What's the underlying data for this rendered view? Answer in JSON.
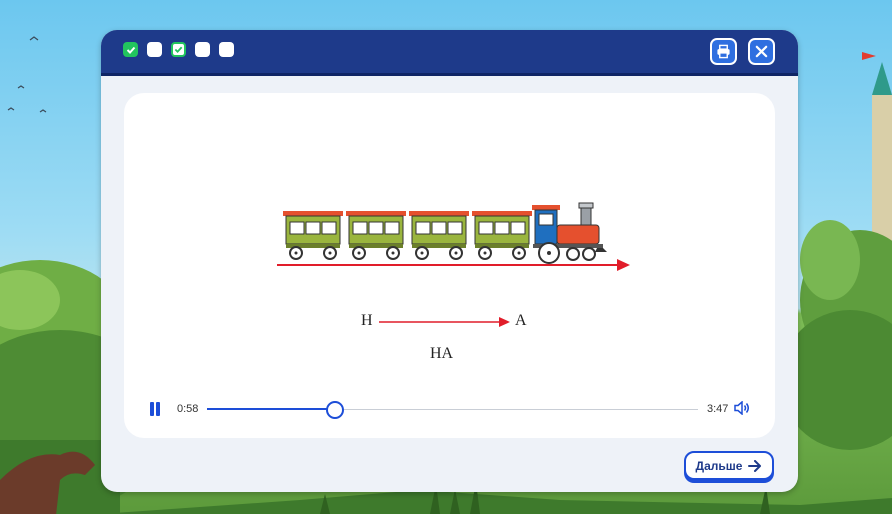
{
  "progress_steps": [
    {
      "state": "completed"
    },
    {
      "state": "pending"
    },
    {
      "state": "completed-outline"
    },
    {
      "state": "pending"
    },
    {
      "state": "pending"
    }
  ],
  "header": {
    "print_icon": "printer-icon",
    "close_icon": "close-icon"
  },
  "diagram": {
    "from_letter": "Н",
    "to_letter": "А",
    "result": "НА",
    "arrow_color": "#e11d2a"
  },
  "player": {
    "elapsed": "0:58",
    "duration": "3:47",
    "progress": 0.26
  },
  "next_button": {
    "label": "Дальше"
  },
  "colors": {
    "accent": "#1d4ed8",
    "header": "#1e3a8a",
    "done": "#22c55e"
  }
}
